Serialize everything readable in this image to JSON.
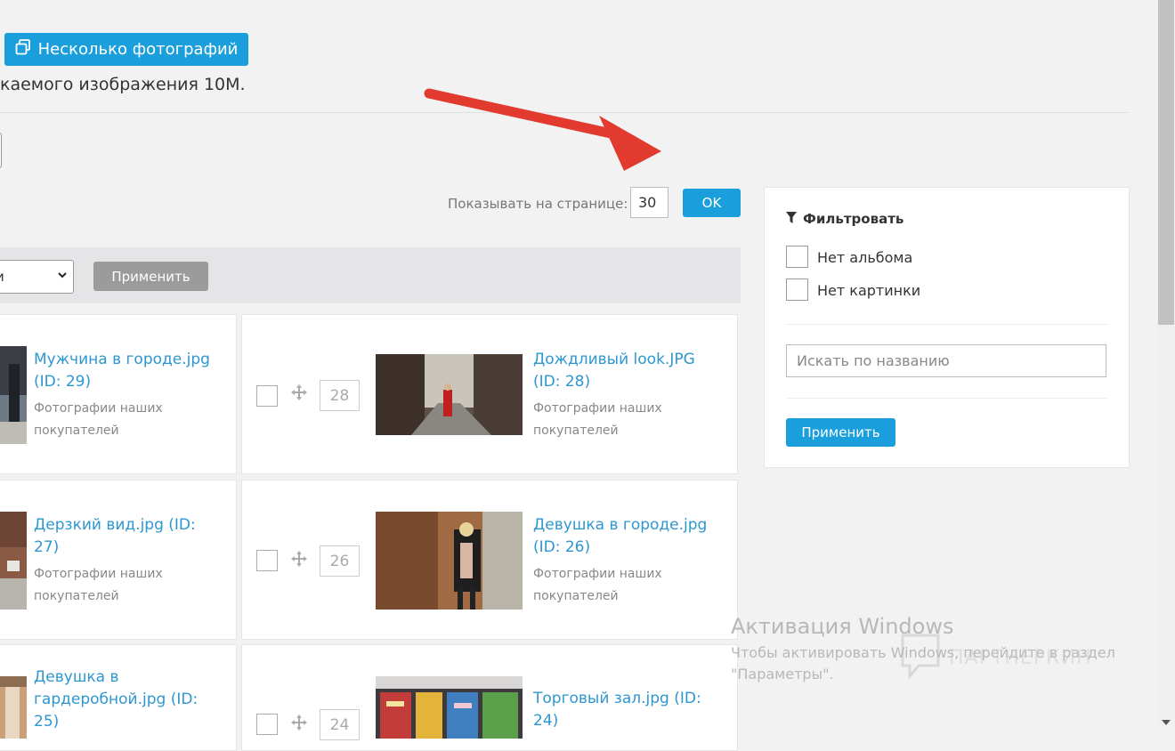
{
  "header": {
    "multi_photo_button": "Несколько фотографий",
    "max_size_text": "каемого изображения 10М."
  },
  "pagination": {
    "per_page_label": "Показывать на странице:",
    "per_page_value": "30",
    "ok_label": "OK"
  },
  "bulk": {
    "select_value": "и",
    "apply_label": "Применить"
  },
  "photos": [
    {
      "title": "Мужчина в городе.jpg",
      "id": "(ID: 29)",
      "album_line1": "Фотографии наших",
      "album_line2": "покупателей"
    },
    {
      "title": "Дождливый look.JPG",
      "id": "(ID: 28)",
      "album_line1": "Фотографии наших",
      "album_line2": "покупателей",
      "position": "28"
    },
    {
      "title_line1": "Дерзкий вид.jpg (ID:",
      "title_line2": "27)",
      "album_line1": "Фотографии наших",
      "album_line2": "покупателей"
    },
    {
      "title": "Девушка в городе.jpg",
      "id": "(ID: 26)",
      "album_line1": "Фотографии наших",
      "album_line2": "покупателей",
      "position": "26"
    },
    {
      "title_line1": "Девушка в",
      "title_line2": "гардеробной.jpg (ID:",
      "title_line3": "25)"
    },
    {
      "title_line1": "Торговый зал.jpg (ID:",
      "title_line2": "24)",
      "position": "24"
    }
  ],
  "filter": {
    "title": "Фильтровать",
    "no_album": "Нет альбома",
    "no_picture": "Нет картинки",
    "search_placeholder": "Искать по названию",
    "apply_label": "Применить"
  },
  "watermark": {
    "title": "Активация Windows",
    "line1": "Чтобы активировать Windows, перейдите в раздел",
    "line2": "\"Параметры\".",
    "brand": "ПАРТНЕРКИН"
  },
  "colors": {
    "accent": "#1a9fdc",
    "link": "#2d97d1",
    "arrow": "#e23a2f"
  }
}
